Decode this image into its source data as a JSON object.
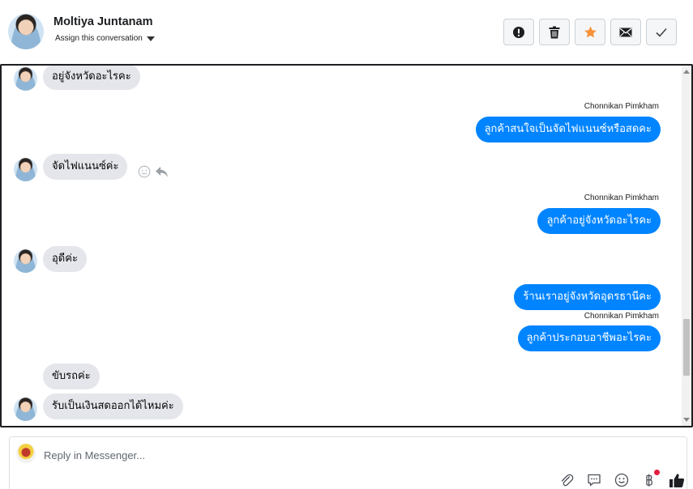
{
  "header": {
    "name": "Moltiya Juntanam",
    "assign_label": "Assign this conversation",
    "actions": [
      {
        "name": "alert",
        "icon": "exclamation-circle-icon"
      },
      {
        "name": "delete",
        "icon": "trash-icon"
      },
      {
        "name": "star",
        "icon": "star-icon",
        "color": "#f7923a"
      },
      {
        "name": "mail",
        "icon": "envelope-icon"
      },
      {
        "name": "done",
        "icon": "check-icon"
      }
    ]
  },
  "messages": {
    "m1": {
      "text": "อยู่จังหวัดอะไรคะ"
    },
    "m2": {
      "sender": "Chonnikan Pimkham",
      "text": "ลูกค้าสนใจเป็นจัดไฟแนนซ์หรือสดคะ"
    },
    "m3": {
      "text": "จัดไฟแนนซ์ค่ะ"
    },
    "m4": {
      "sender": "Chonnikan Pimkham",
      "text": "ลูกค้าอยู่จังหวัดอะไรคะ"
    },
    "m5": {
      "text": "อุดีค่ะ"
    },
    "m6": {
      "text": "ร้านเราอยู่จังหวัดอุดรธานีคะ"
    },
    "m7": {
      "sender": "Chonnikan Pimkham",
      "text": "ลูกค้าประกอบอาชีพอะไรคะ"
    },
    "m8": {
      "text": "ขับรถค่ะ"
    },
    "m9": {
      "text": "รับเป็นเงินสดออกได้ไหมค่ะ"
    }
  },
  "composer": {
    "placeholder": "Reply in Messenger...",
    "tools": [
      "paperclip-icon",
      "speech-bubble-icon",
      "smiley-icon",
      "baht-icon",
      "thumbs-up-icon"
    ],
    "accent": "#0084ff"
  }
}
